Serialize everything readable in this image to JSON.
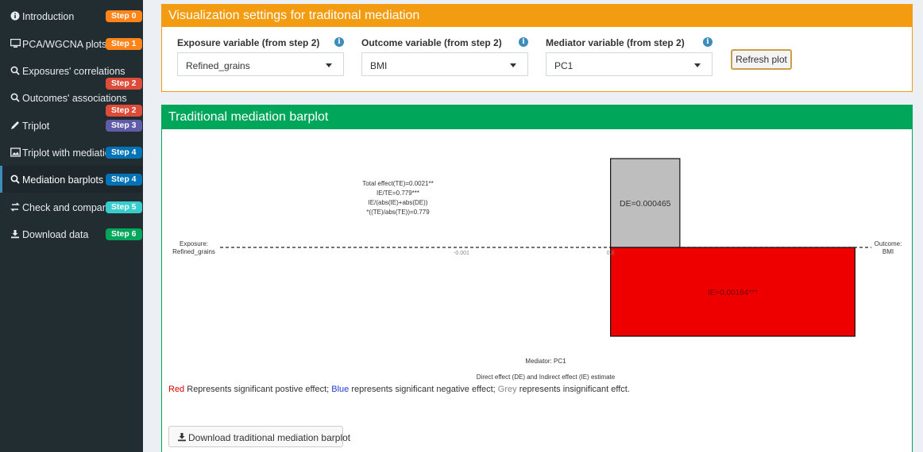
{
  "sidebar": {
    "items": [
      {
        "label": "Introduction",
        "icon": "info-circle-icon",
        "badges": [
          {
            "text": "Step 0",
            "color": "#ff851b"
          }
        ]
      },
      {
        "label": "PCA/WGCNA plots",
        "icon": "desktop-icon",
        "badges": [
          {
            "text": "Step 1",
            "color": "#ff851b"
          }
        ]
      },
      {
        "label": "Exposures' correlations",
        "icon": "search-icon",
        "badges": [
          {
            "text": "Step 2",
            "color": "#dd4b39"
          }
        ]
      },
      {
        "label": "Outcomes' associations",
        "icon": "search-icon",
        "badges": [
          {
            "text": "Step 2",
            "color": "#dd4b39"
          }
        ]
      },
      {
        "label": "Triplot",
        "icon": "pencil-icon",
        "badges": [
          {
            "text": "Step 3",
            "color": "#605ca8"
          }
        ]
      },
      {
        "label": "Triplot with mediation",
        "icon": "image-icon",
        "badges": [
          {
            "text": "Step 4",
            "color": "#0073b7"
          }
        ]
      },
      {
        "label": "Mediation barplots",
        "icon": "search-icon",
        "badges": [
          {
            "text": "Step 4",
            "color": "#0073b7"
          }
        ],
        "active": true
      },
      {
        "label": "Check and compare",
        "icon": "exchange-icon",
        "badges": [
          {
            "text": "Step 5",
            "color": "#39cccc"
          }
        ]
      },
      {
        "label": "Download data",
        "icon": "download-icon",
        "badges": [
          {
            "text": "Step 6",
            "color": "#00a65a"
          }
        ]
      }
    ]
  },
  "settings": {
    "title": "Visualization settings for traditonal mediation",
    "exposure": {
      "label": "Exposure variable (from step 2)",
      "value": "Refined_grains"
    },
    "outcome": {
      "label": "Outcome variable (from step 2)",
      "value": "BMI"
    },
    "mediator": {
      "label": "Mediator variable (from step 2)",
      "value": "PC1"
    },
    "refresh_label": "Refresh plot"
  },
  "plot_box": {
    "title": "Traditional mediation barplot",
    "legend": {
      "red": "Red",
      "red_text": " Represents significant postive effect; ",
      "blue": "Blue",
      "blue_text": " represents significant negative effect; ",
      "grey": "Grey",
      "grey_text": " represents insignificant effct."
    },
    "download_label": "Download traditional mediation barplot"
  },
  "chart_data": {
    "type": "bar",
    "title": "",
    "xlabel": "Mediator: PC1",
    "xlabel2": "Direct effect (DE) and Indirect effect (IE) estimate",
    "left_label": [
      "Exposure:",
      "Refined_grains"
    ],
    "right_label": [
      "Outcome:",
      "BMI"
    ],
    "annotation": [
      "Total effect(TE)=0.0021**",
      "IE/TE=0.779***",
      "IE/(abs(IE)+abs(DE))",
      "*((TE)/abs(TE))=0.779"
    ],
    "x_ticks": [
      -0.001,
      0
    ],
    "x_tick_labels": [
      "-0.001",
      "0.0"
    ],
    "xlim": [
      -0.00262,
      0.00175
    ],
    "bars": [
      {
        "name": "DE",
        "label": "DE=0.000465",
        "start": 0,
        "end": 0.000465,
        "color": "#bebebe",
        "text_color": "#333333"
      },
      {
        "name": "IE",
        "label": "IE=0.00164***",
        "start": 0,
        "end": 0.00164,
        "color": "#ee0000",
        "text_color": "#7a0000"
      }
    ]
  }
}
